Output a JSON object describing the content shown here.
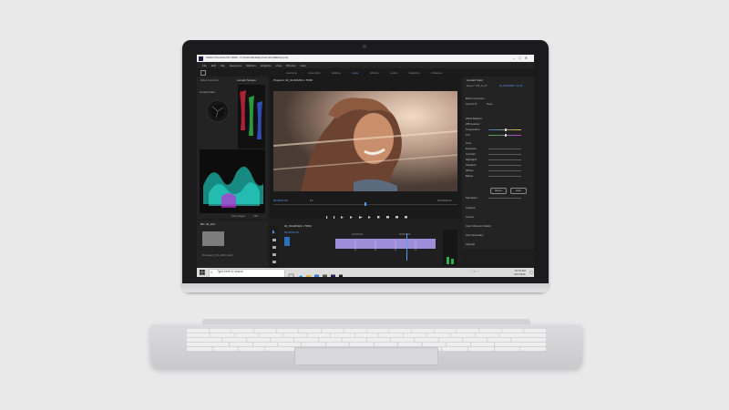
{
  "app": {
    "title": "Adobe Premiere Pro 2020 - C:\\Users\\Desktop\\Converted\\Edit.prproj"
  },
  "menu": [
    "File",
    "Edit",
    "Clip",
    "Sequence",
    "Markers",
    "Graphics",
    "View",
    "Window",
    "Help"
  ],
  "workspaces": {
    "items": [
      "Learning",
      "Assembly",
      "Editing",
      "Color",
      "Effects",
      "Audio",
      "Graphics",
      "Libraries"
    ],
    "active": "Color"
  },
  "scopes": {
    "tab1": "Effect Controls",
    "tab2": "Lumetri Scopes",
    "clamp": "Clamp Signal",
    "bit": "8 Bit"
  },
  "program": {
    "tab": "Program: 02_SCARVES x TRIM",
    "timecode": "00:00:01:03",
    "fit": "Fit",
    "duration": "00:00:09:21"
  },
  "lumetri": {
    "tab": "Lumetri Color",
    "master": "Master * 04Z_03_02",
    "clip": "02_SCARVES * 04_03",
    "fx": "Lumetri Color",
    "basic": "Basic Correction",
    "input": "Input LUT",
    "input_value": "None",
    "wb": "White Balance",
    "wb_selector": "WB Selector",
    "temperature": "Temperature",
    "tint": "Tint",
    "tone": "Tone",
    "exposure": "Exposure",
    "contrast": "Contrast",
    "highlights": "Highlights",
    "shadows": "Shadows",
    "whites": "Whites",
    "blacks": "Blacks",
    "reset": "Reset",
    "auto": "Auto",
    "saturation": "Saturation",
    "creative": "Creative",
    "curves": "Curves",
    "color_wheels": "Color Wheels & Match",
    "hsl": "HSL Secondary",
    "vignette": "Vignette"
  },
  "project": {
    "tab": "Bin: 02_b01",
    "item": "Previewed_0_01_2020_0.wtm"
  },
  "timeline": {
    "tab": "02_SCARVES x TRIM",
    "timecode": "00:00:01:03",
    "clip1": "00:00:00:00",
    "clip2": "00:00:01:00"
  },
  "taskbar": {
    "search": "Type here to search",
    "time": "10:15 AM",
    "date": "4/27/2020"
  }
}
